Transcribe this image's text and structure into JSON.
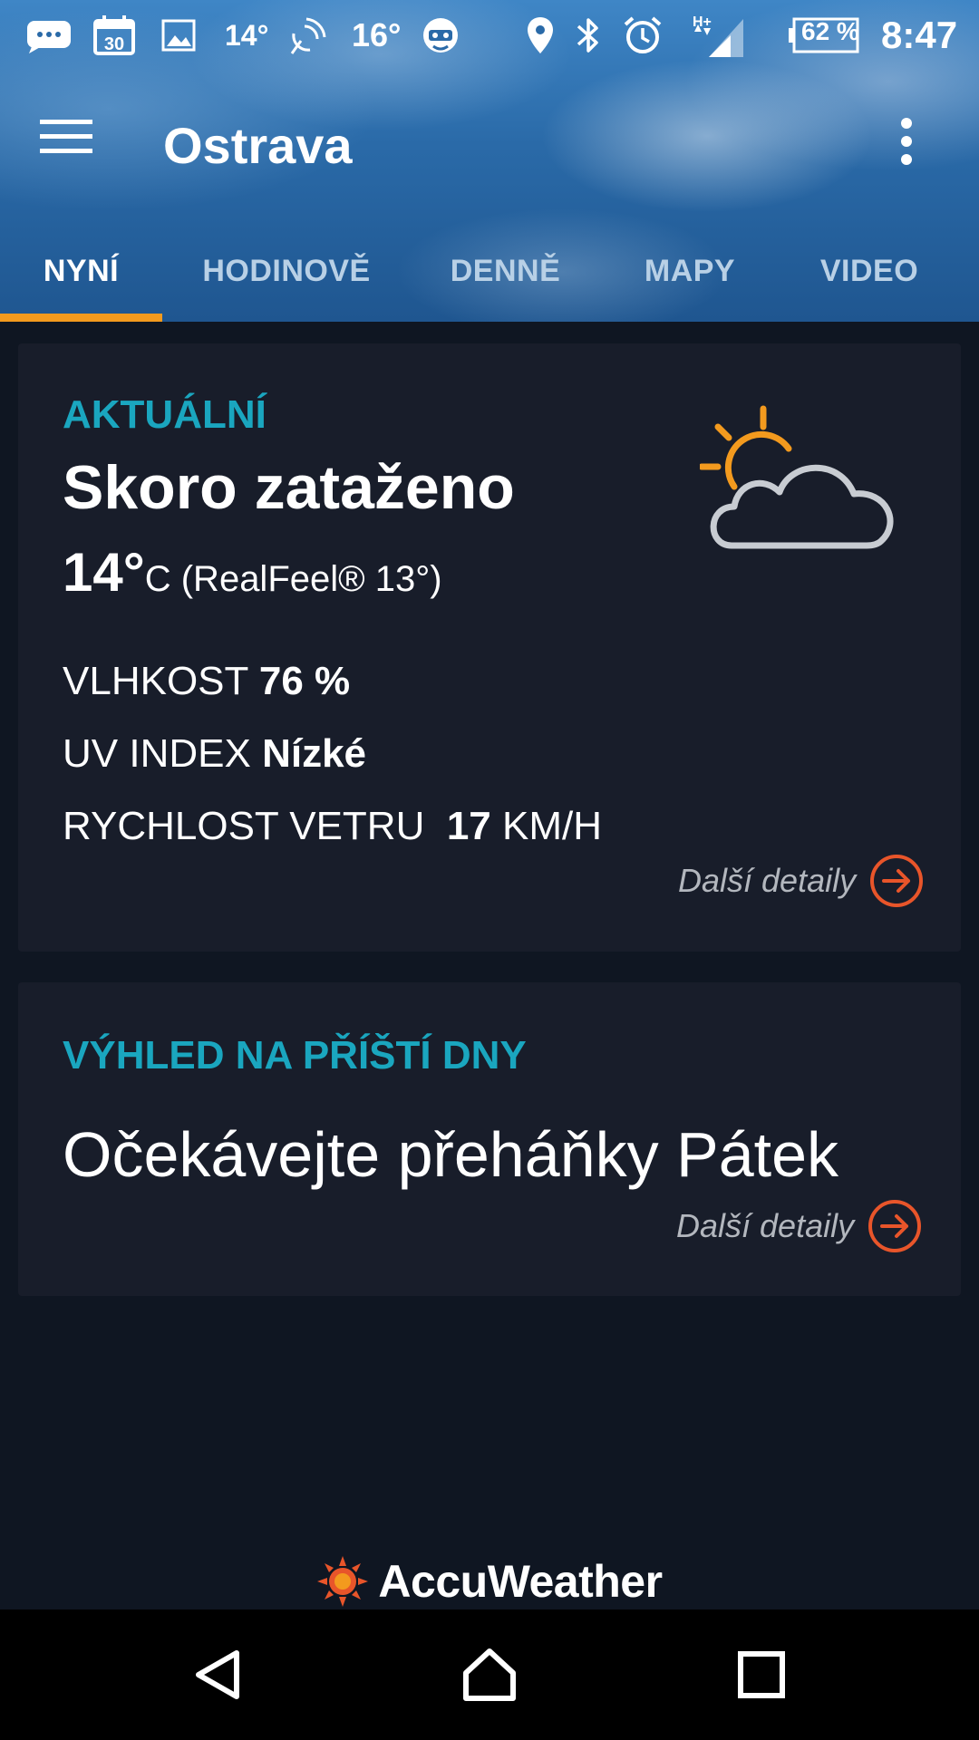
{
  "status_bar": {
    "temp_small": "14°",
    "temp_large": "16°",
    "battery": "62 %",
    "time": "8:47",
    "network": "H+",
    "calendar_day": "30"
  },
  "app_bar": {
    "title": "Ostrava"
  },
  "tabs": [
    {
      "label": "NYNÍ",
      "active": true
    },
    {
      "label": "HODINOVĚ",
      "active": false
    },
    {
      "label": "DENNĚ",
      "active": false
    },
    {
      "label": "MAPY",
      "active": false
    },
    {
      "label": "VIDEO",
      "active": false
    }
  ],
  "current": {
    "section_label": "AKTUÁLNÍ",
    "condition": "Skoro zataženo",
    "temperature": "14°",
    "temp_unit_realfeel": "C (RealFeel® 13°)",
    "humidity_label": "VLHKOST",
    "humidity_value": "76 %",
    "uv_label": "UV INDEX",
    "uv_value": "Nízké",
    "wind_label": "RYCHLOST VETRU",
    "wind_value": "17",
    "wind_unit": "KM/H",
    "more_label": "Další detaily",
    "icon": "partly-cloudy-icon"
  },
  "outlook": {
    "section_label": "VÝHLED NA PŘÍŠTÍ DNY",
    "text": "Očekávejte přeháňky Pátek",
    "more_label": "Další detaily"
  },
  "footer": {
    "brand": "AccuWeather"
  },
  "colors": {
    "accent_orange": "#f39a1e",
    "teal": "#1aa6bf",
    "link_orange": "#e8552a",
    "card_bg": "#181d2a",
    "page_bg": "#0f1622"
  }
}
